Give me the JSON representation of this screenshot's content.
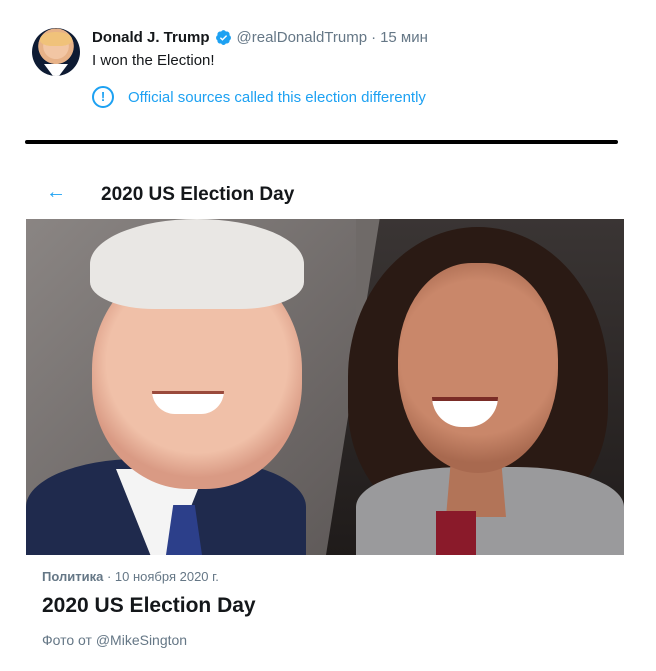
{
  "tweet": {
    "author_name": "Donald J. Trump",
    "handle": "@realDonaldTrump",
    "separator": "·",
    "time": "15 мин",
    "text": "I won the Election!",
    "notice": "Official sources called this election differently",
    "notice_icon": "!"
  },
  "moment": {
    "title": "2020 US Election Day",
    "back_icon": "←"
  },
  "card": {
    "category": "Политика",
    "separator": "·",
    "date": "10 ноября 2020 г.",
    "headline": "2020 US Election Day",
    "credit": "Фото от @MikeSington"
  },
  "colors": {
    "accent": "#1da1f2",
    "text": "#14171a",
    "secondary": "#657786"
  },
  "icons": {
    "verified": "verified-badge-icon",
    "notice": "info-exclamation-icon",
    "back": "back-arrow-icon"
  }
}
